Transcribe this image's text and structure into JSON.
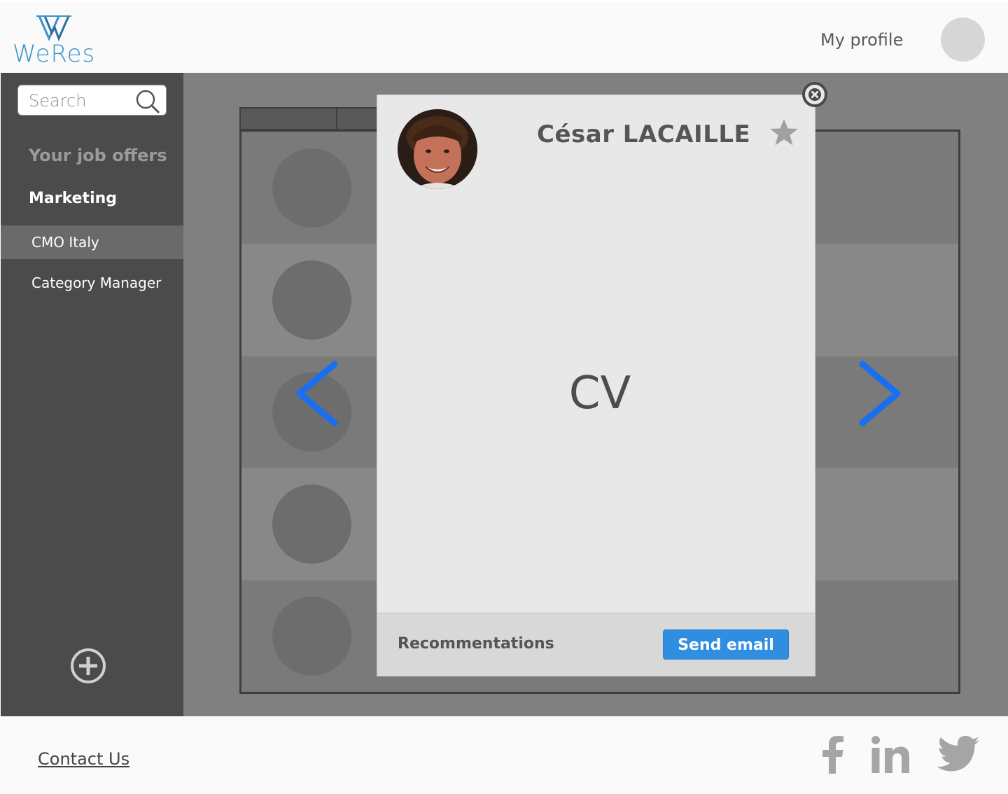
{
  "header": {
    "logo_text": "WeRes",
    "my_profile_label": "My profile"
  },
  "sidebar": {
    "search_placeholder": "Search",
    "title": "Your job offers",
    "section": "Marketing",
    "items": [
      {
        "label": "CMO Italy",
        "active": true
      },
      {
        "label": "Category Manager",
        "active": false
      }
    ]
  },
  "modal": {
    "candidate_name": "César LACAILLE",
    "cv_label": "CV",
    "recommendations_label": "Recommentations",
    "send_email_label": "Send email"
  },
  "footer": {
    "contact_label": "Contact Us",
    "social": [
      "facebook-icon",
      "linkedin-icon",
      "twitter-icon"
    ]
  },
  "colors": {
    "brand": "#3a93c7",
    "accent_button": "#2f8ee0",
    "arrow": "#1a6ff0",
    "sidebar_bg": "#4b4b4b",
    "sidebar_active": "#6a6a6a"
  }
}
